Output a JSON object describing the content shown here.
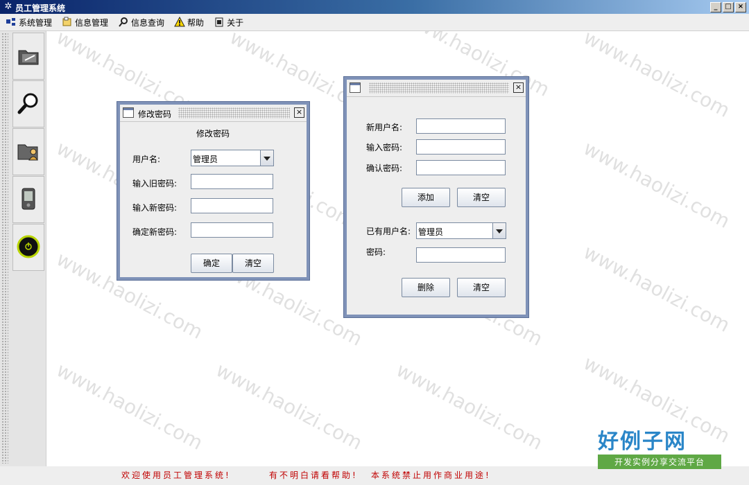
{
  "window": {
    "title": "员工管理系统",
    "icon": "app-logo-icon",
    "controls": [
      "minimize",
      "maximize",
      "close"
    ]
  },
  "menu": {
    "items": [
      {
        "label": "系统管理",
        "icon": "system-icon"
      },
      {
        "label": "信息管理",
        "icon": "info-icon"
      },
      {
        "label": "信息查询",
        "icon": "search-icon"
      },
      {
        "label": "帮助",
        "icon": "warning-icon"
      },
      {
        "label": "关于",
        "icon": "about-icon"
      }
    ]
  },
  "toolbar": {
    "tools": [
      {
        "icon": "folder-edit-icon"
      },
      {
        "icon": "magnifier-icon"
      },
      {
        "icon": "folder-user-icon"
      },
      {
        "icon": "pda-icon"
      },
      {
        "icon": "power-icon"
      }
    ]
  },
  "change_password": {
    "heading": "修改密码",
    "panel_title": "修改密码",
    "username_label": "用户名:",
    "username_value": "管理员",
    "old_password_label": "输入旧密码:",
    "old_password_value": "",
    "new_password_label": "输入新密码:",
    "new_password_value": "",
    "confirm_password_label": "确定新密码:",
    "confirm_password_value": "",
    "confirm_button": "确定",
    "clear_button": "清空"
  },
  "user_admin": {
    "new_user_label": "新用户名:",
    "new_user_value": "",
    "password_label": "输入密码:",
    "password_value": "",
    "confirm_label": "确认密码:",
    "confirm_value": "",
    "add_button": "添加",
    "clear_button_1": "清空",
    "existing_user_label": "已有用户名:",
    "existing_user_value": "管理员",
    "existing_password_label": "密码:",
    "existing_password_value": "",
    "delete_button": "删除",
    "clear_button_2": "清空"
  },
  "watermark": "www.haolizi.com",
  "status": {
    "msg1": "欢迎使用员工管理系统!",
    "msg2": "有不明白请看帮助!",
    "msg3": "本系统禁止用作商业用途!"
  },
  "brand": {
    "main": "好例子网",
    "sub": "开发实例分享交流平台"
  },
  "colors": {
    "title_gradient_start": "#0a246a",
    "frame_border": "#7f92b8",
    "status_text": "#c00000",
    "brand_blue": "#2a86c8",
    "brand_green": "#5fa845"
  }
}
